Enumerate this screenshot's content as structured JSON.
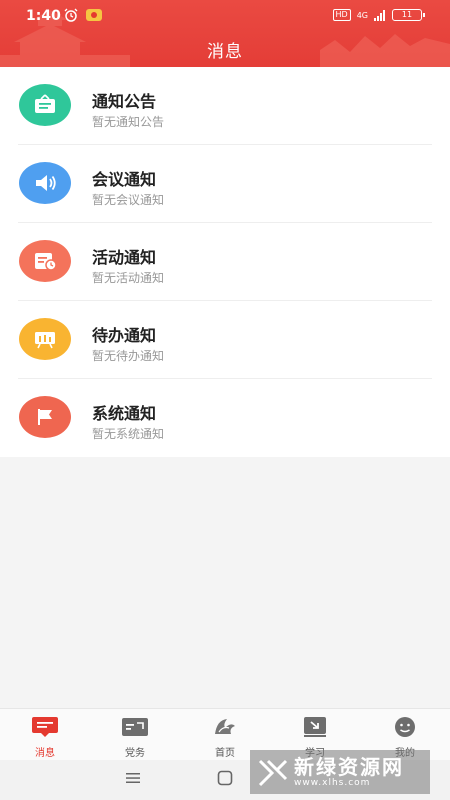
{
  "status_bar": {
    "time": "1:40",
    "network_badge": "HD",
    "signal_text": "4G",
    "battery_level": "11"
  },
  "header": {
    "title": "消息"
  },
  "messages": [
    {
      "title": "通知公告",
      "subtitle": "暂无通知公告",
      "icon": "notice-board-icon",
      "color": "#2fc79a"
    },
    {
      "title": "会议通知",
      "subtitle": "暂无会议通知",
      "icon": "speaker-icon",
      "color": "#4f9ff0"
    },
    {
      "title": "活动通知",
      "subtitle": "暂无活动通知",
      "icon": "calendar-clock-icon",
      "color": "#f4735b"
    },
    {
      "title": "待办通知",
      "subtitle": "暂无待办通知",
      "icon": "todo-board-icon",
      "color": "#f9b431"
    },
    {
      "title": "系统通知",
      "subtitle": "暂无系统通知",
      "icon": "flag-icon",
      "color": "#ef6650"
    }
  ],
  "tabs": [
    {
      "label": "消息",
      "icon": "message-icon",
      "active": true
    },
    {
      "label": "党务",
      "icon": "party-affairs-icon",
      "active": false
    },
    {
      "label": "首页",
      "icon": "home-logo-icon",
      "active": false
    },
    {
      "label": "学习",
      "icon": "study-icon",
      "active": false
    },
    {
      "label": "我的",
      "icon": "profile-face-icon",
      "active": false
    }
  ],
  "watermark": {
    "main": "新绿资源网",
    "sub": "www.xlhs.com"
  },
  "colors": {
    "brand_red": "#e4392f",
    "active_tab": "#e4392f"
  }
}
